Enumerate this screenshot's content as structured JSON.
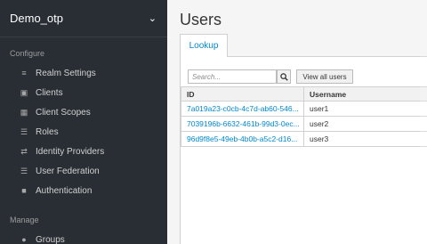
{
  "realm": {
    "name": "Demo_otp"
  },
  "sidebar": {
    "configure_label": "Configure",
    "configure_items": [
      {
        "label": "Realm Settings",
        "icon": "sliders-icon"
      },
      {
        "label": "Clients",
        "icon": "cube-icon"
      },
      {
        "label": "Client Scopes",
        "icon": "cubes-icon"
      },
      {
        "label": "Roles",
        "icon": "roles-icon"
      },
      {
        "label": "Identity Providers",
        "icon": "exchange-icon"
      },
      {
        "label": "User Federation",
        "icon": "database-icon"
      },
      {
        "label": "Authentication",
        "icon": "lock-icon"
      }
    ],
    "manage_label": "Manage",
    "manage_items": [
      {
        "label": "Groups",
        "icon": "users-icon"
      }
    ]
  },
  "main": {
    "title": "Users",
    "tab_lookup": "Lookup",
    "search": {
      "placeholder": "Search..."
    },
    "view_all_label": "View all users",
    "table": {
      "headers": {
        "id": "ID",
        "username": "Username"
      },
      "rows": [
        {
          "id": "7a019a23-c0cb-4c7d-ab60-546...",
          "username": "user1"
        },
        {
          "id": "7039196b-6632-461b-99d3-0ec...",
          "username": "user2"
        },
        {
          "id": "96d9f8e5-49eb-4b0b-a5c2-d16...",
          "username": "user3"
        }
      ]
    }
  },
  "colors": {
    "sidebar_bg": "#292e34",
    "link": "#0088ce",
    "page_bg": "#f5f5f5"
  }
}
